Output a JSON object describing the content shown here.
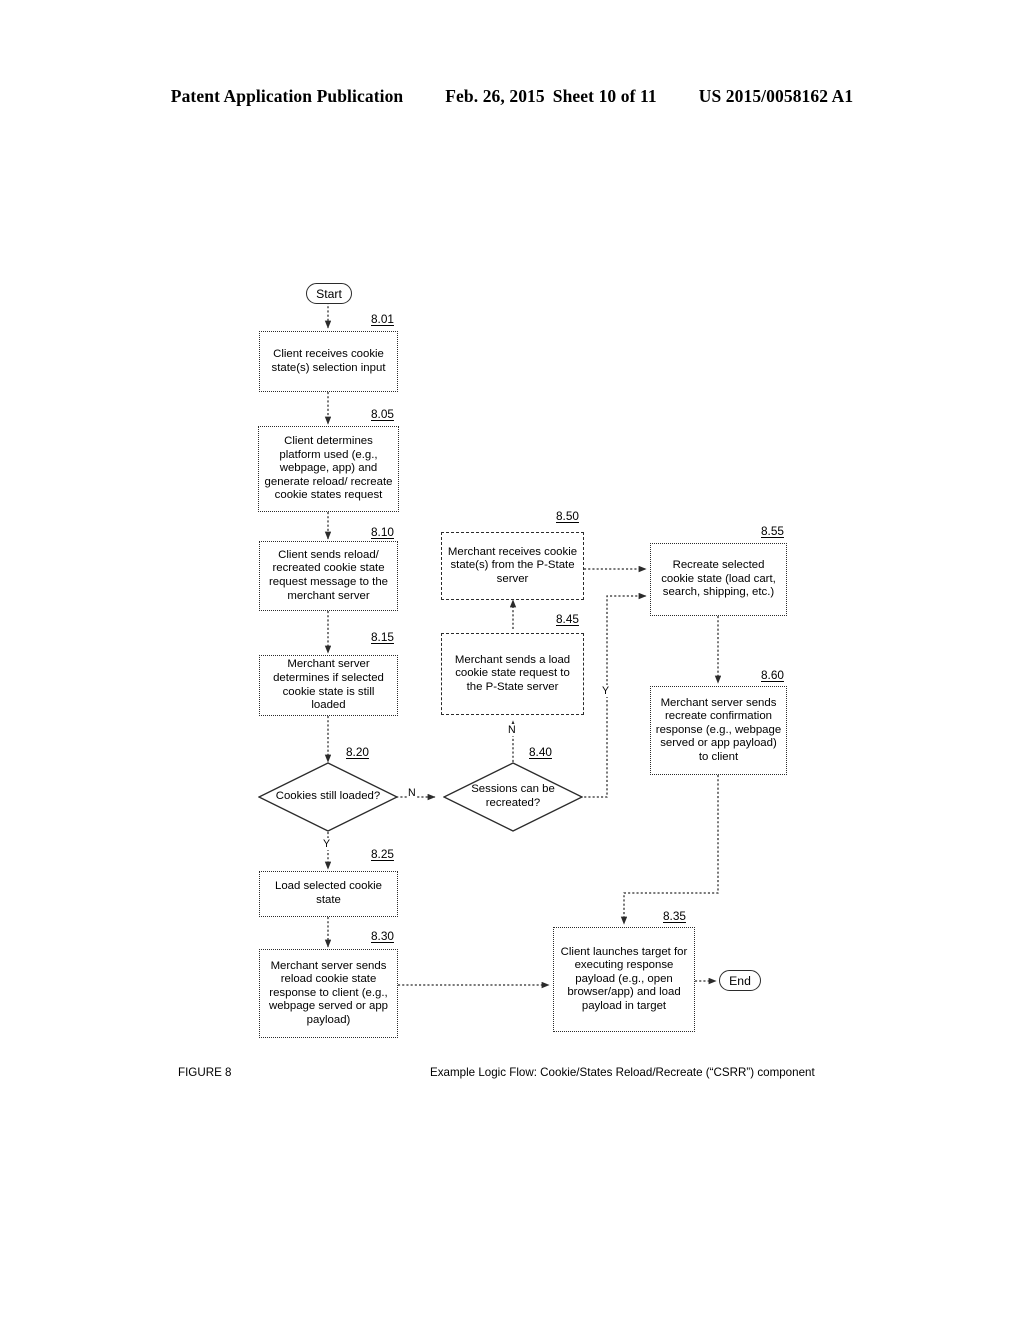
{
  "header": {
    "publication": "Patent Application Publication",
    "date": "Feb. 26, 2015",
    "sheet": "Sheet 10 of 11",
    "number": "US 2015/0058162 A1"
  },
  "footer": {
    "figure_label": "FIGURE 8",
    "caption": "Example Logic Flow: Cookie/States Reload/Recreate (“CSRR”) component"
  },
  "terminators": {
    "start": "Start",
    "end": "End"
  },
  "refs": {
    "r801": "8.01",
    "r805": "8.05",
    "r810": "8.10",
    "r815": "8.15",
    "r820": "8.20",
    "r825": "8.25",
    "r830": "8.30",
    "r835": "8.35",
    "r840": "8.40",
    "r845": "8.45",
    "r850": "8.50",
    "r855": "8.55",
    "r860": "8.60"
  },
  "nodes": {
    "n801": "Client receives cookie state(s) selection input",
    "n805": "Client determines platform used (e.g., webpage, app) and generate reload/ recreate cookie states request",
    "n810": "Client sends reload/ recreated cookie state request message to the merchant server",
    "n815": "Merchant server determines if selected cookie state is still loaded",
    "n820": "Cookies still loaded?",
    "n825": "Load selected cookie state",
    "n830": "Merchant server sends reload cookie state response to client (e.g., webpage served or app payload)",
    "n835": "Client launches target for executing response payload (e.g., open browser/app) and load payload in target",
    "n840": "Sessions can be recreated?",
    "n845": "Merchant sends a load cookie state request to the P-State server",
    "n850": "Merchant receives cookie state(s) from the P-State server",
    "n855": "Recreate selected cookie state (load cart, search, shipping, etc.)",
    "n860": "Merchant server sends recreate confirmation response (e.g., webpage served or app payload) to client"
  },
  "branch_labels": {
    "b820_no": "N",
    "b820_yes": "Y",
    "b840_no": "N",
    "b840_yes": "Y"
  },
  "colors": {
    "stroke": "#2b2b2b",
    "background": "#ffffff",
    "text": "#000000"
  }
}
